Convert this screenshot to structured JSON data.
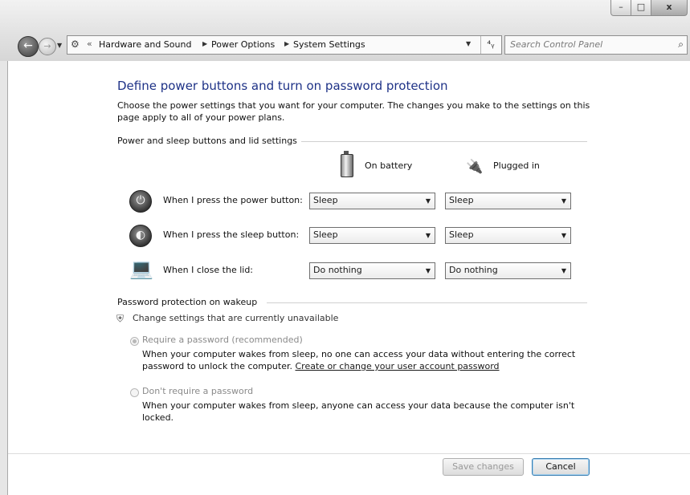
{
  "window": {
    "controls": {
      "minimize": "–",
      "maximize": "□",
      "close": "x"
    }
  },
  "navigation": {
    "back_glyph": "←",
    "forward_glyph": "→",
    "recent_glyph": "▼",
    "address_icon": "control-panel-icon",
    "address_chevron": "«",
    "breadcrumbs": [
      "Hardware and Sound",
      "Power Options",
      "System Settings"
    ],
    "separator": "▶",
    "dropdown_glyph": "▼",
    "refresh_glyph": "⁴ᵧ",
    "search_placeholder": "Search Control Panel",
    "search_glyph": "⌕"
  },
  "page": {
    "title": "Define power buttons and turn on password protection",
    "intro": "Choose the power settings that you want for your computer. The changes you make to the settings on this page apply to all of your power plans.",
    "section_buttons": "Power and sleep buttons and lid settings",
    "columns": {
      "battery": "On battery",
      "plugged": "Plugged in"
    },
    "rows": [
      {
        "label": "When I press the power button:",
        "icon": "power-button-icon",
        "battery": "Sleep",
        "plugged": "Sleep"
      },
      {
        "label": "When I press the sleep button:",
        "icon": "sleep-button-icon",
        "battery": "Sleep",
        "plugged": "Sleep"
      },
      {
        "label": "When I close the lid:",
        "icon": "laptop-lid-icon",
        "battery": "Do nothing",
        "plugged": "Do nothing"
      }
    ],
    "section_password": "Password protection on wakeup",
    "change_settings": "Change settings that are currently unavailable",
    "require": {
      "label": "Require a password (recommended)",
      "desc": "When your computer wakes from sleep, no one can access your data without entering the correct password to unlock the computer.",
      "link": "Create or change your user account password",
      "selected": true
    },
    "no_require": {
      "label": "Don't require a password",
      "desc": "When your computer wakes from sleep, anyone can access your data because the computer isn't locked.",
      "selected": false
    }
  },
  "footer": {
    "save": "Save changes",
    "cancel": "Cancel"
  },
  "colors": {
    "title": "#1e3287",
    "disabled": "#8a8a8a",
    "focus_border": "#3c7fb1"
  }
}
